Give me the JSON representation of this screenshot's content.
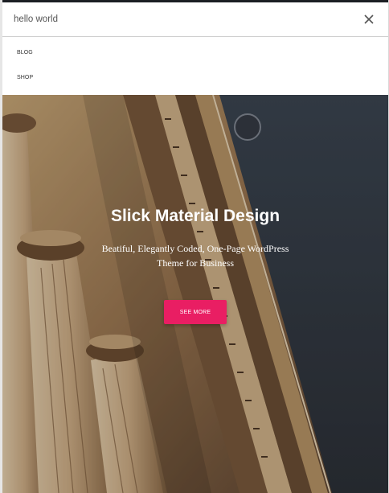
{
  "search": {
    "value": "hello world"
  },
  "menu": {
    "items": [
      {
        "label": "BLOG"
      },
      {
        "label": "SHOP"
      }
    ]
  },
  "hero": {
    "title": "Slick Material Design",
    "subtitle_line1": "Beatiful, Elegantly Coded, One-Page WordPress",
    "subtitle_line2": "Theme for Business",
    "cta_label": "SEE MORE"
  },
  "colors": {
    "accent": "#e91e63",
    "sky": "#3a414b",
    "stone": "#b89466"
  },
  "icons": {
    "close": "close-icon"
  }
}
